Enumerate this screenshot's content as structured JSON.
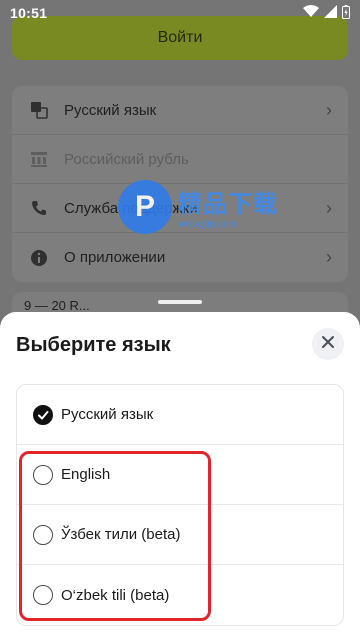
{
  "status_bar": {
    "time": "10:51"
  },
  "background": {
    "login_button": "Войти",
    "menu_items": [
      {
        "label": "Русский язык",
        "icon": "translate-icon",
        "chevron": true,
        "disabled": false
      },
      {
        "label": "Российский рубль",
        "icon": "bank-icon",
        "chevron": false,
        "disabled": true
      },
      {
        "label": "Служба поддержки",
        "icon": "phone-support-icon",
        "chevron": true,
        "disabled": false
      },
      {
        "label": "О приложении",
        "icon": "info-icon",
        "chevron": true,
        "disabled": false
      }
    ],
    "promo_text": "9 — 20 R..."
  },
  "watermark": {
    "title": "精品下载",
    "url": "www.j9p.com"
  },
  "sheet": {
    "title": "Выберите язык",
    "languages": [
      {
        "label": "Русский язык",
        "selected": true
      },
      {
        "label": "English",
        "selected": false
      },
      {
        "label": "Ўзбек тили (beta)",
        "selected": false
      },
      {
        "label": "O‘zbek tili (beta)",
        "selected": false
      }
    ]
  },
  "colors": {
    "accent": "#7a8a22",
    "highlight": "#e0262b",
    "check": "#111111"
  }
}
